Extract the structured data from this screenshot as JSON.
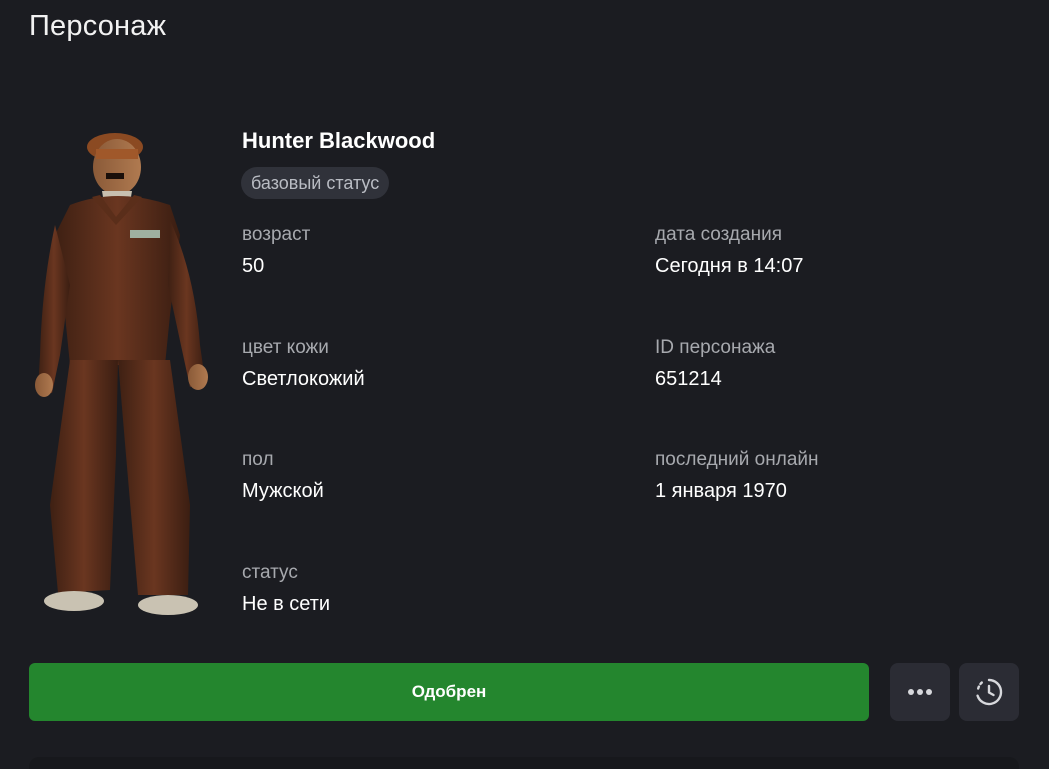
{
  "header": {
    "title": "Персонаж"
  },
  "character": {
    "name": "Hunter Blackwood",
    "status_badge": "базовый статус",
    "fields": [
      {
        "label": "возраст",
        "value": "50"
      },
      {
        "label": "дата создания",
        "value": "Сегодня в 14:07"
      },
      {
        "label": "цвет кожи",
        "value": "Светлокожий"
      },
      {
        "label": "ID персонажа",
        "value": "651214"
      },
      {
        "label": "пол",
        "value": "Мужской"
      },
      {
        "label": "последний онлайн",
        "value": "1 января 1970"
      },
      {
        "label": "статус",
        "value": "Не в сети"
      }
    ]
  },
  "actions": {
    "approve_label": "Одобрен",
    "more_icon": "more-horizontal-icon",
    "history_icon": "history-clock-icon"
  },
  "colors": {
    "background": "#1b1c21",
    "accent_green": "#24862e",
    "badge_bg": "#30323a",
    "icon_button_bg": "#2b2c34"
  }
}
